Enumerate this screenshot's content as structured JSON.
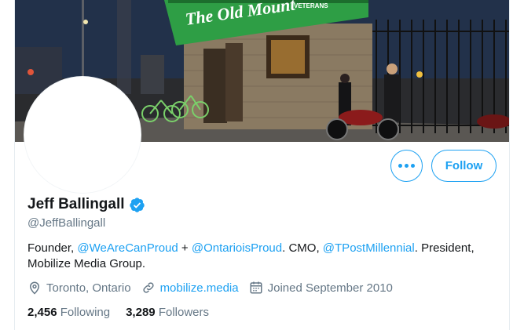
{
  "banner": {
    "sign_text": "The Old Mount",
    "sign_small_text": "VETERANS"
  },
  "profile": {
    "name": "Jeff Ballingall",
    "handle": "@JeffBallingall",
    "bio": {
      "part1": "Founder, ",
      "mention1": "@WeAreCanProud",
      "part2": " + ",
      "mention2": "@OntarioisProud",
      "part3": ". CMO, ",
      "mention3": "@TPostMillennial",
      "part4": ". President, Mobilize Media Group."
    },
    "location": "Toronto, Ontario",
    "website": "mobilize.media",
    "joined": "Joined September 2010"
  },
  "actions": {
    "follow_label": "Follow"
  },
  "stats": {
    "following_count": "2,456",
    "following_label": "Following",
    "followers_count": "3,289",
    "followers_label": "Followers"
  },
  "colors": {
    "accent": "#1da1f2",
    "secondary_text": "#657786",
    "primary_text": "#14171a"
  },
  "icons": {
    "more": "more-horizontal-icon",
    "verified": "verified-badge-icon",
    "location": "location-pin-icon",
    "link": "link-icon",
    "calendar": "calendar-icon"
  }
}
